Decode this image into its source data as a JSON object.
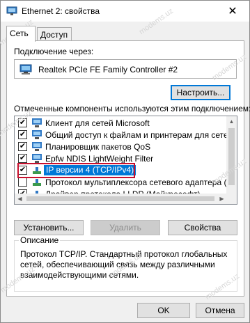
{
  "window": {
    "title": "Ethernet 2: свойства",
    "close_glyph": "✕"
  },
  "tabs": [
    {
      "label": "Сеть"
    },
    {
      "label": "Доступ"
    }
  ],
  "connection": {
    "label": "Подключение через:",
    "adapter": "Realtek PCIe FE Family Controller #2",
    "configure_button": "Настроить..."
  },
  "components": {
    "label": "Отмеченные компоненты используются этим подключением:",
    "items": [
      {
        "label": "Клиент для сетей Microsoft",
        "checked": true,
        "icon": "network-client-icon"
      },
      {
        "label": "Общий доступ к файлам и принтерам для сетей Mi",
        "checked": true,
        "icon": "file-sharing-icon"
      },
      {
        "label": "Планировщик пакетов QoS",
        "checked": true,
        "icon": "qos-icon"
      },
      {
        "label": "Epfw NDIS LightWeight Filter",
        "checked": true,
        "icon": "filter-icon"
      },
      {
        "label": "IP версии 4 (TCP/IPv4)",
        "checked": true,
        "icon": "protocol-icon",
        "selected": true
      },
      {
        "label": "Протокол мультиплексора сетевого адаптера (Май",
        "checked": false,
        "icon": "protocol-icon"
      },
      {
        "label": "Драйвер протокола LLDP (Майкрософт)",
        "checked": true,
        "icon": "protocol-icon"
      }
    ],
    "check_glyph": "✔"
  },
  "buttons": {
    "install": "Установить...",
    "remove": "Удалить",
    "properties": "Свойства"
  },
  "description": {
    "legend": "Описание",
    "line1": "Протокол TCP/IP. Стандартный протокол глобальных",
    "line2": "сетей, обеспечивающий связь между различными",
    "line3": "взаимодействующими сетями."
  },
  "footer": {
    "ok": "OK",
    "cancel": "Отмена"
  },
  "watermark": "modems.uz",
  "colors": {
    "selection": "#0078d7",
    "highlight_border": "#c8102e",
    "focus": "#0078d7"
  }
}
